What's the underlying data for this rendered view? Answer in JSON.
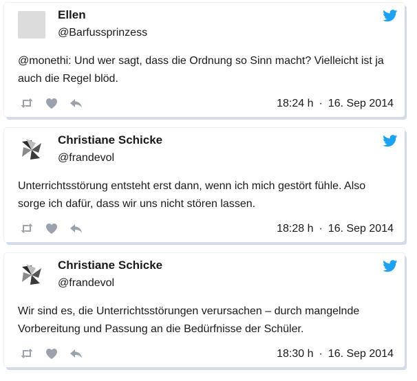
{
  "tweets": [
    {
      "name": "Ellen",
      "handle": "@Barfussprinzess",
      "text": "@monethi: Und wer sagt, dass die Ordnung so Sinn macht? Vielleicht ist ja auch die Regel blöd.",
      "time": "18:24 h",
      "date": "16. Sep 2014",
      "avatar": "placeholder"
    },
    {
      "name": "Christiane Schicke",
      "handle": "@frandevol",
      "text": "Unterrichtsstörung entsteht erst dann, wenn ich mich gestört fühle. Also sorge ich dafür, dass wir uns nicht stören lassen.",
      "time": "18:28 h",
      "date": "16. Sep 2014",
      "avatar": "pinwheel"
    },
    {
      "name": "Christiane Schicke",
      "handle": "@frandevol",
      "text": "Wir sind es, die Unterrichtsstörungen verursachen – durch mangelnde Vorbereitung und Passung an die Bedürfnisse der Schüler.",
      "time": "18:30 h",
      "date": "16. Sep 2014",
      "avatar": "pinwheel"
    }
  ],
  "separator": "·",
  "icons": {
    "brand": "twitter-bird-icon",
    "actions": [
      "retweet-icon",
      "like-heart-icon",
      "reply-icon"
    ]
  },
  "colors": {
    "twitter_blue": "#1da1f2",
    "action_gray": "#9aa3ad",
    "card_shadow": "#d4dbe8"
  }
}
